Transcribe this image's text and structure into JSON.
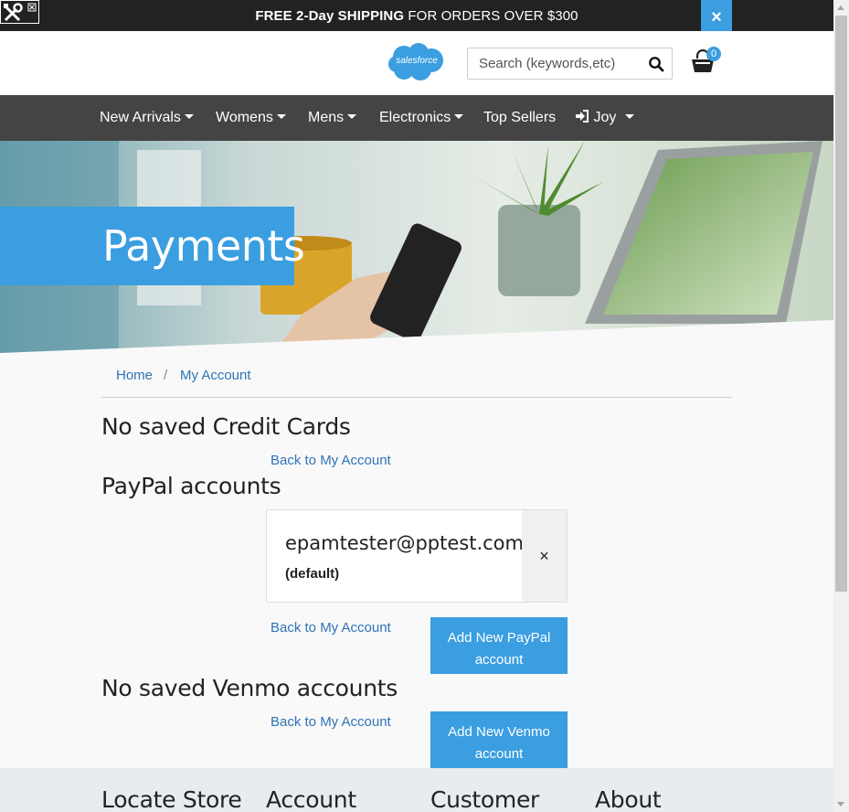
{
  "promo": {
    "bold_text": "FREE 2-Day SHIPPING",
    "rest_text": " FOR ORDERS OVER $300",
    "close_icon": "close-icon",
    "close_glyph": "×"
  },
  "header": {
    "logo_text": "salesforce",
    "search_placeholder": "Search (keywords,etc)",
    "search_icon": "search-icon",
    "cart_icon": "shopping-bag-icon",
    "cart_count": "0"
  },
  "nav": {
    "items": [
      {
        "label": "New Arrivals",
        "dropdown": true
      },
      {
        "label": "Womens",
        "dropdown": true
      },
      {
        "label": "Mens",
        "dropdown": true
      },
      {
        "label": "Electronics",
        "dropdown": true
      },
      {
        "label": "Top Sellers",
        "dropdown": false
      },
      {
        "label": "Joy",
        "dropdown": true,
        "icon": "sign-in-icon"
      }
    ]
  },
  "hero": {
    "title": "Payments"
  },
  "breadcrumb": {
    "home": "Home",
    "separator": "/",
    "account": "My Account"
  },
  "credit_cards": {
    "heading": "No saved Credit Cards",
    "back_link": "Back to My Account"
  },
  "paypal": {
    "heading": "PayPal accounts",
    "email": "epamtester@pptest.com",
    "default_label": "(default)",
    "remove_glyph": "×",
    "back_link": "Back to My Account",
    "add_button": "Add New PayPal account"
  },
  "venmo": {
    "heading": "No saved Venmo accounts",
    "back_link": "Back to My Account",
    "add_button": "Add New Venmo account"
  },
  "footer": {
    "headings": [
      "Locate Store",
      "Account",
      "Customer",
      "About"
    ]
  },
  "colors": {
    "accent": "#3a9ee0",
    "nav_bg": "#444444",
    "promo_bg": "#222222",
    "link": "#2f73b8"
  }
}
